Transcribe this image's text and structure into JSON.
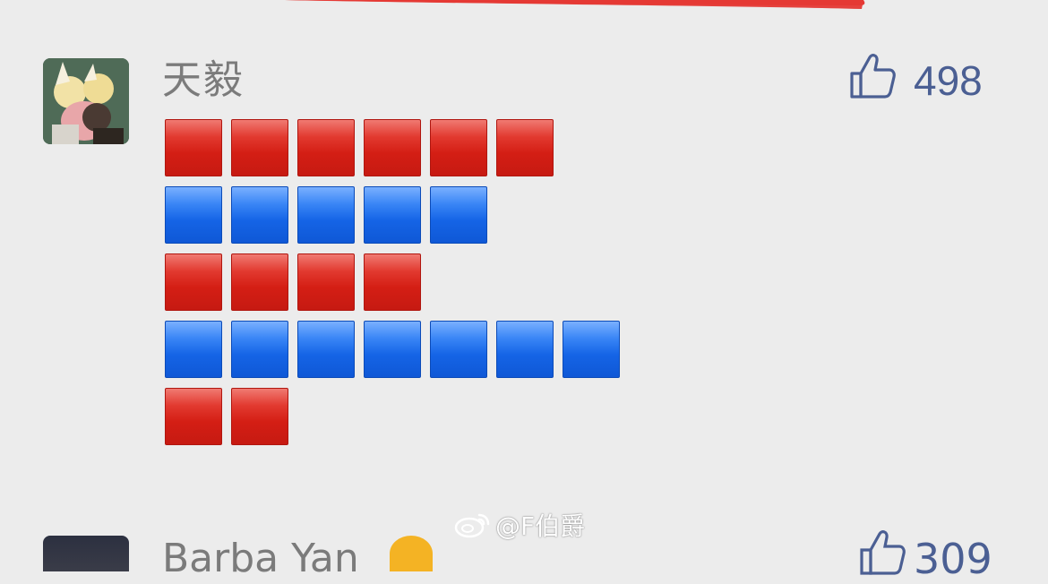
{
  "comment": {
    "username": "天毅",
    "like_count": "498",
    "emoji_rows": [
      {
        "color": "red",
        "count": 6
      },
      {
        "color": "blue",
        "count": 5
      },
      {
        "color": "red",
        "count": 4
      },
      {
        "color": "blue",
        "count": 7
      },
      {
        "color": "red",
        "count": 2
      }
    ]
  },
  "next_comment": {
    "username_partial": "Barba  Yan",
    "like_count_partial": "309"
  },
  "watermark": {
    "text": "@F伯爵"
  },
  "colors": {
    "accent_red": "#e53935",
    "emoji_red": "#d41e14",
    "emoji_blue": "#1564e6",
    "like_blue": "#4b5f93",
    "background": "#ececec"
  },
  "icons": {
    "like": "thumbs-up-icon",
    "watermark": "weibo-logo-icon"
  }
}
